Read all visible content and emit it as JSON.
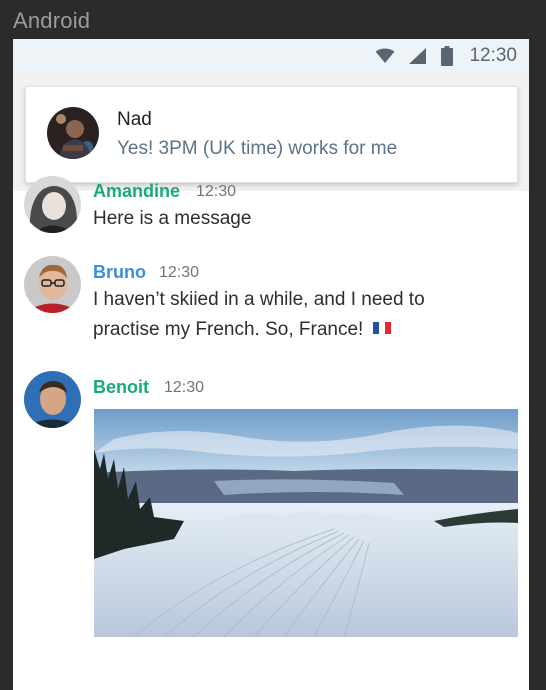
{
  "window": {
    "title": "Android"
  },
  "status_bar": {
    "time": "12:30",
    "icons": [
      "wifi-icon",
      "signal-icon",
      "battery-icon"
    ]
  },
  "notification": {
    "sender": "Nad",
    "message": "Yes! 3PM (UK time) works for me"
  },
  "messages": [
    {
      "name": "Amandine",
      "time": "12:30",
      "text": "Here is a message",
      "name_color": "#1aaa7a"
    },
    {
      "name": "Bruno",
      "time": "12:30",
      "text": "I haven’t skiied in a while, and I need to practise my French. So, France!",
      "name_color": "#3b8fd8",
      "emoji": "flag-fr"
    },
    {
      "name": "Benoit",
      "time": "12:30",
      "name_color": "#1aaa7a",
      "attachment": "ski-slope-photo"
    }
  ],
  "colors": {
    "accent_green": "#1aaa7a",
    "accent_blue": "#3b8fd8",
    "status_bar_bg": "#eef3f8"
  }
}
